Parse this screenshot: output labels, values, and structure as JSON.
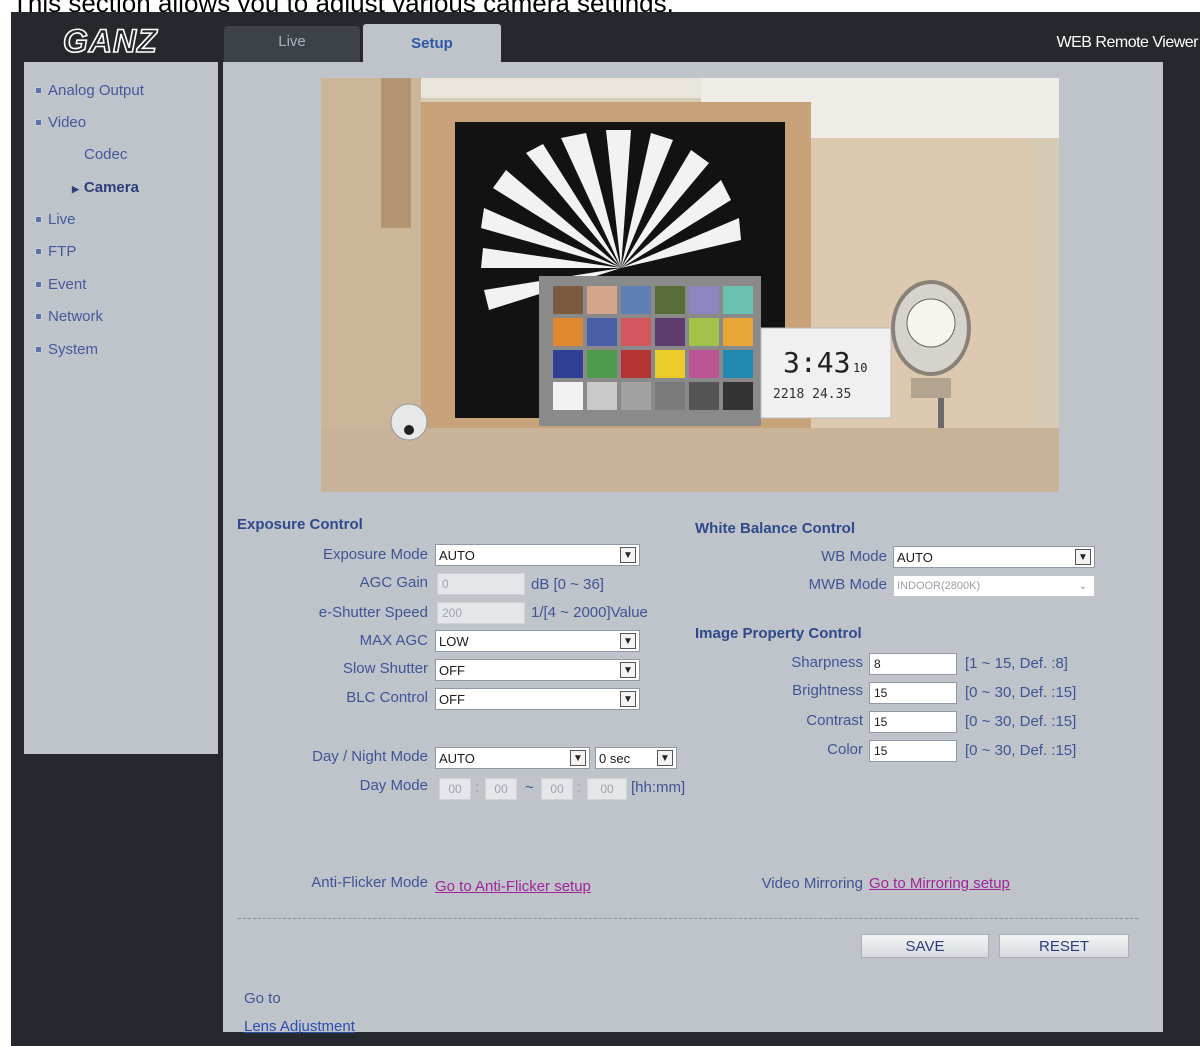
{
  "caption": "This section allows you to adjust various camera settings.",
  "brand": {
    "logo": "GANZ",
    "app_title": "WEB Remote Viewer"
  },
  "tabs": [
    {
      "label": "Live",
      "active": false
    },
    {
      "label": "Setup",
      "active": true
    }
  ],
  "sidebar": {
    "items": [
      {
        "label": "Analog Output"
      },
      {
        "label": "Video",
        "children": [
          "Codec",
          "Camera"
        ]
      },
      {
        "label": "Live"
      },
      {
        "label": "FTP"
      },
      {
        "label": "Event"
      },
      {
        "label": "Network"
      },
      {
        "label": "System"
      }
    ],
    "active_child": "Camera"
  },
  "camera_view": {
    "clock_time": "3:43",
    "clock_seconds": "10",
    "clock_date": "2218 24.35"
  },
  "exposure": {
    "title": "Exposure Control",
    "mode_label": "Exposure Mode",
    "mode_value": "AUTO",
    "agc_gain_label": "AGC Gain",
    "agc_gain_value": "0",
    "agc_gain_unit": "dB [0 ~ 36]",
    "shutter_label": "e-Shutter Speed",
    "shutter_value": "200",
    "shutter_unit": "1/[4 ~ 2000]Value",
    "max_agc_label": "MAX AGC",
    "max_agc_value": "LOW",
    "slow_shutter_label": "Slow Shutter",
    "slow_shutter_value": "OFF",
    "blc_label": "BLC Control",
    "blc_value": "OFF",
    "day_night_label": "Day / Night Mode",
    "day_night_value": "AUTO",
    "day_night_delay": "0 sec",
    "day_mode_label": "Day Mode",
    "day_mode_from_h": "00",
    "day_mode_from_m": "00",
    "day_mode_to_h": "00",
    "day_mode_to_m": "00",
    "day_mode_unit": "[hh:mm]"
  },
  "white_balance": {
    "title": "White Balance Control",
    "wb_mode_label": "WB Mode",
    "wb_mode_value": "AUTO",
    "mwb_mode_label": "MWB Mode",
    "mwb_mode_value": "INDOOR(2800K)"
  },
  "image_property": {
    "title": "Image Property Control",
    "rows": [
      {
        "label": "Sharpness",
        "value": "8",
        "range": "[1 ~ 15, Def. :8]"
      },
      {
        "label": "Brightness",
        "value": "15",
        "range": "[0 ~ 30, Def. :15]"
      },
      {
        "label": "Contrast",
        "value": "15",
        "range": "[0 ~ 30, Def. :15]"
      },
      {
        "label": "Color",
        "value": "15",
        "range": "[0 ~ 30, Def. :15]"
      }
    ]
  },
  "anti_flicker": {
    "label": "Anti-Flicker Mode",
    "link": "Go to Anti-Flicker setup"
  },
  "mirroring": {
    "label": "Video Mirroring",
    "link": "Go to Mirroring setup"
  },
  "buttons": {
    "save": "SAVE",
    "reset": "RESET"
  },
  "goto": {
    "label": "Go to",
    "link": "Lens Adjustment"
  },
  "colors": {
    "frame": "#25282c",
    "panel": "#bfc4cb",
    "label": "#3e5595",
    "link": "#a0249a"
  }
}
